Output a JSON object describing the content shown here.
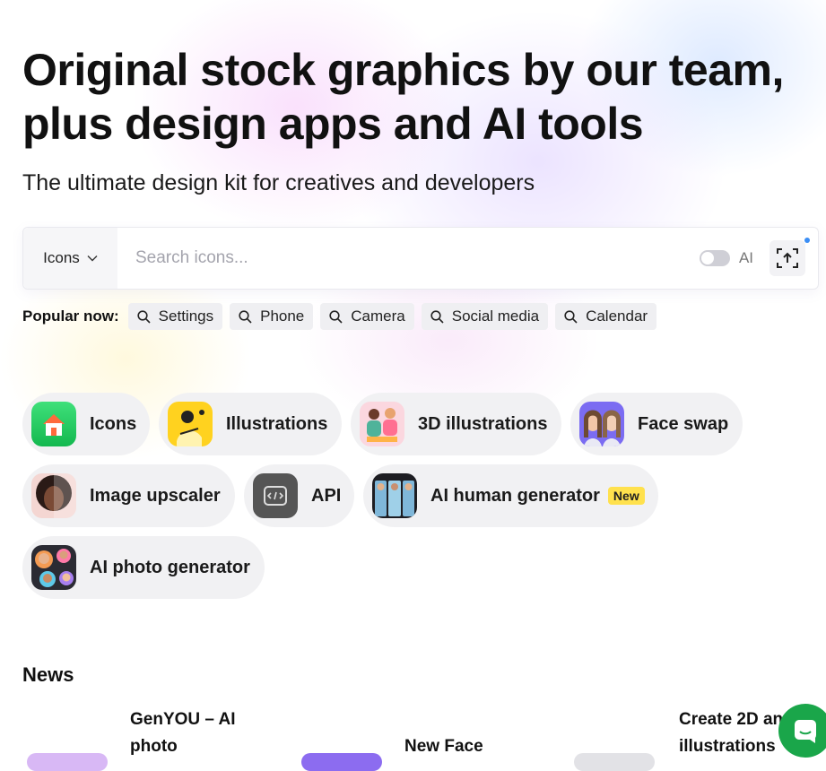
{
  "hero": {
    "headline_line1": "Original stock graphics by our team,",
    "headline_line2": "plus design apps and AI tools",
    "subtitle": "The ultimate design kit for creatives and developers"
  },
  "search": {
    "type_label": "Icons",
    "placeholder": "Search icons...",
    "ai_label": "AI",
    "ai_enabled": false
  },
  "popular": {
    "label": "Popular now:",
    "chips": [
      "Settings",
      "Phone",
      "Camera",
      "Social media",
      "Calendar"
    ]
  },
  "categories": {
    "icons": "Icons",
    "illustrations": "Illustrations",
    "illustrations_3d": "3D illustrations",
    "face_swap": "Face swap",
    "image_upscaler": "Image upscaler",
    "api": "API",
    "ai_human_generator": "AI human generator",
    "new_badge": "New",
    "ai_photo_generator": "AI photo generator"
  },
  "news": {
    "title": "News",
    "items": [
      "GenYOU – AI photo",
      "New Face",
      "Create 2D and 3D illustrations"
    ]
  },
  "colors": {
    "accent_blue": "#3b8ef5",
    "chat_green": "#1aa64a",
    "new_badge_yellow": "#ffe14d"
  }
}
